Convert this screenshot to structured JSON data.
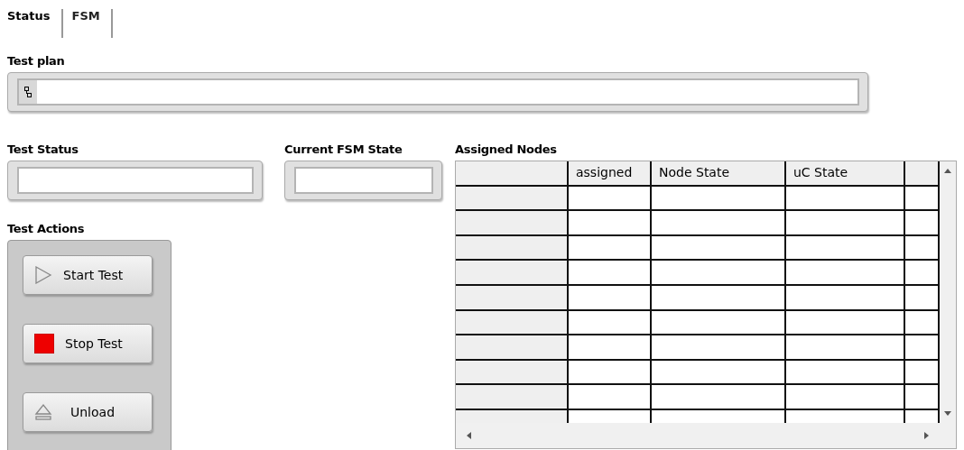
{
  "tabs": [
    {
      "label": "Status",
      "selected": true
    },
    {
      "label": "FSM",
      "selected": false
    }
  ],
  "test_plan": {
    "label": "Test plan"
  },
  "test_status": {
    "label": "Test Status"
  },
  "current_fsm_state": {
    "label": "Current FSM State"
  },
  "test_actions": {
    "label": "Test Actions",
    "buttons": [
      {
        "label": "Start Test",
        "kind": "start"
      },
      {
        "label": "Stop Test",
        "kind": "stop"
      },
      {
        "label": "Unload",
        "kind": "unload"
      }
    ]
  },
  "assigned_nodes": {
    "label": "Assigned Nodes",
    "columns": [
      "assigned",
      "Node State",
      "uC State"
    ]
  }
}
